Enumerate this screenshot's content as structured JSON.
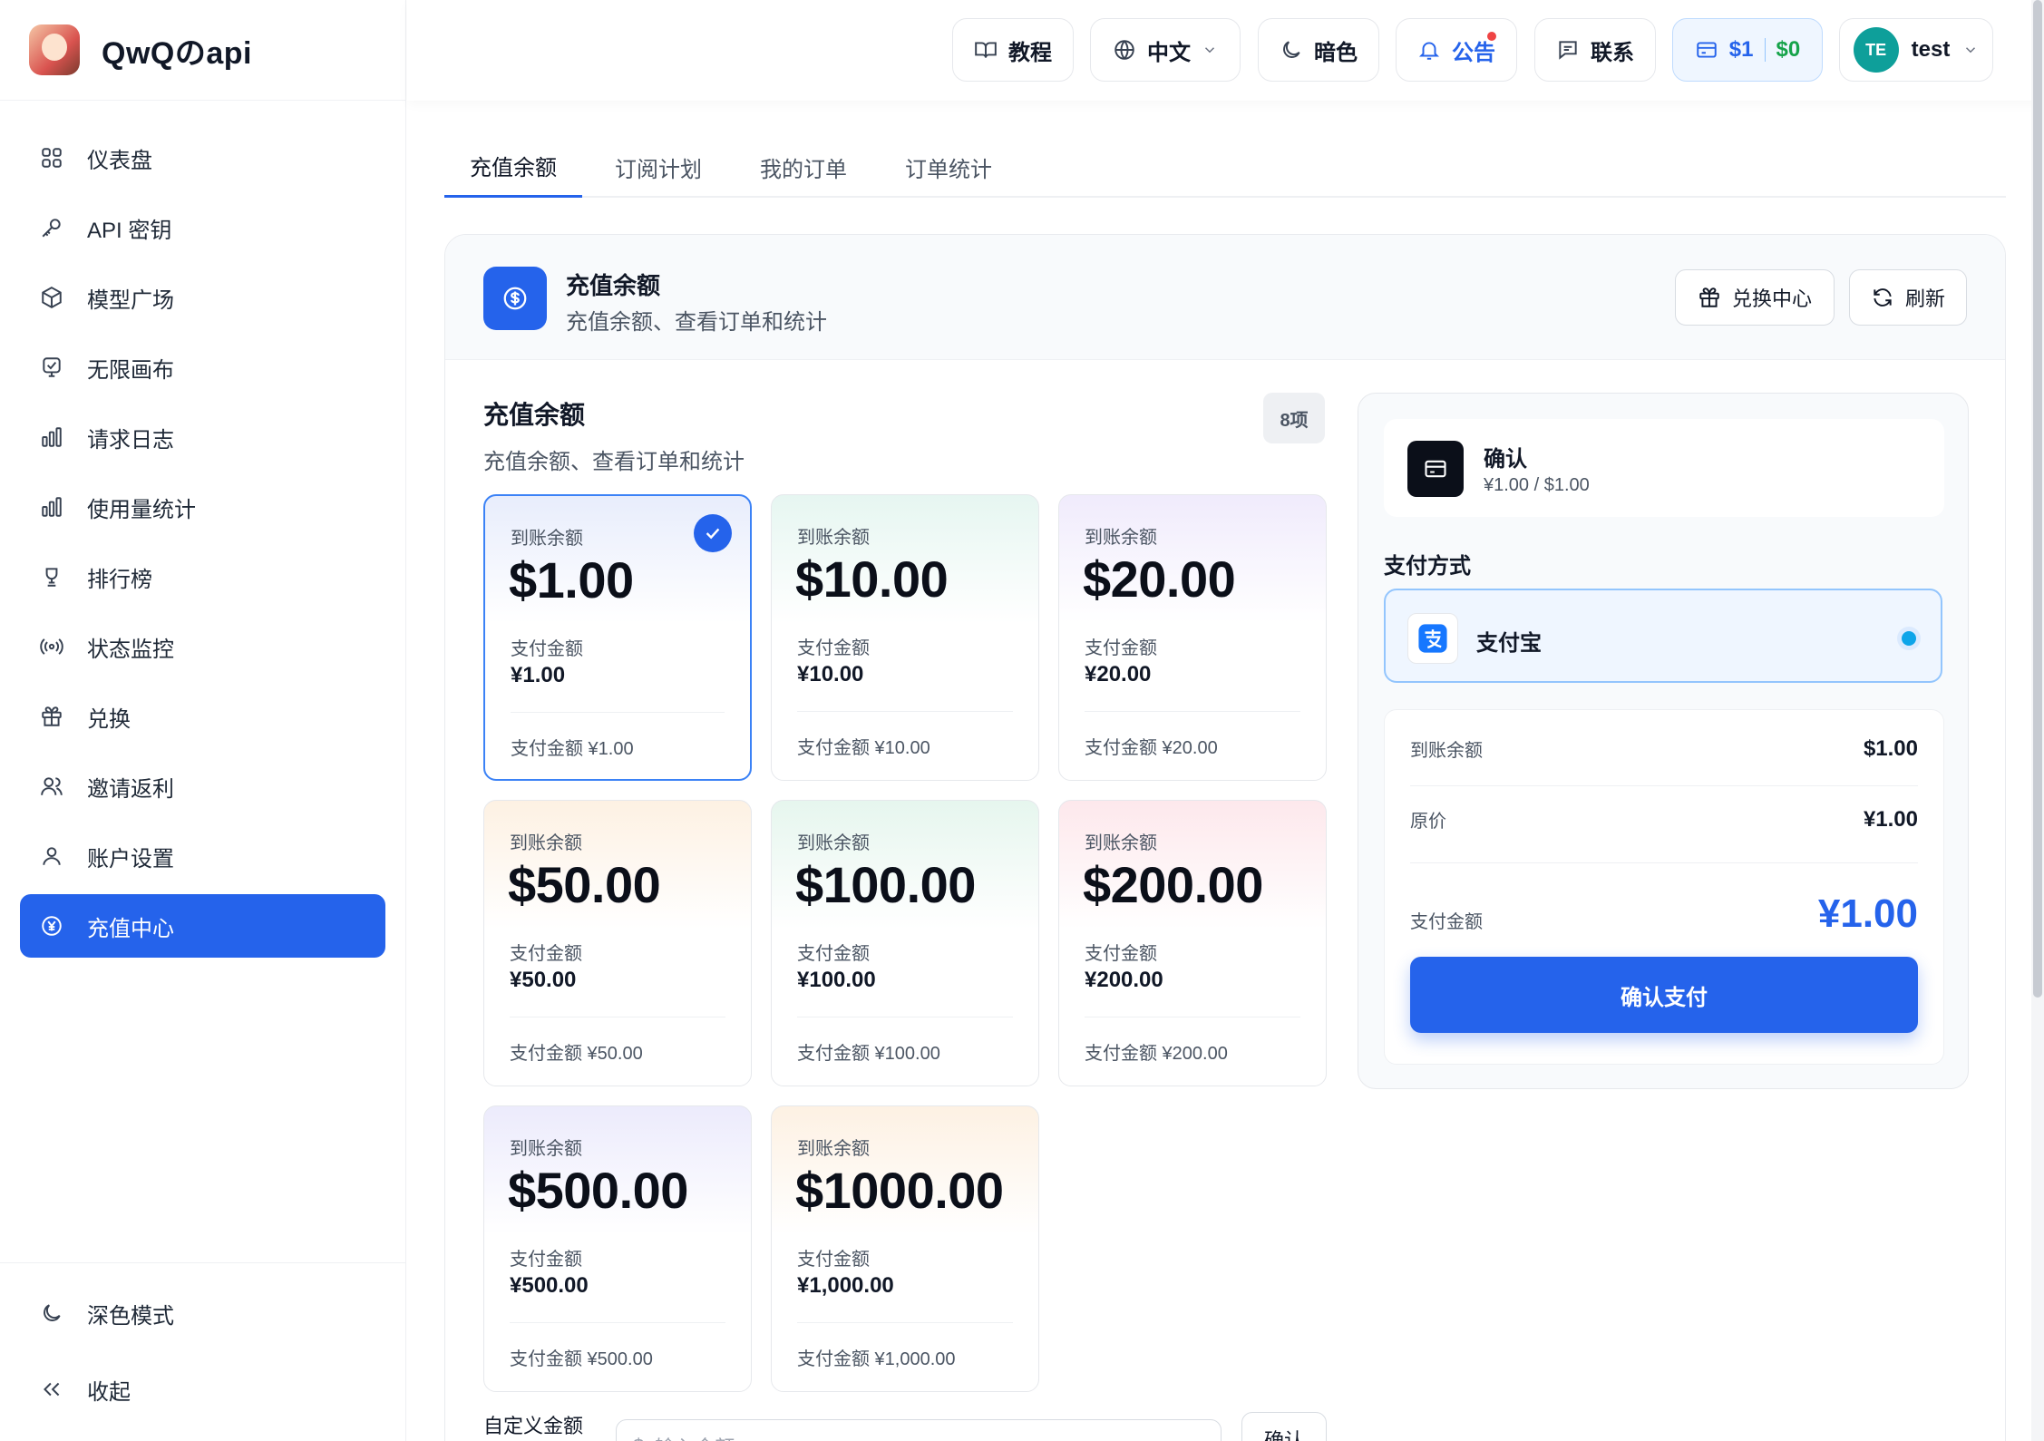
{
  "brand": {
    "name": "QwQのapi"
  },
  "sidebar": {
    "items": [
      {
        "label": "仪表盘",
        "icon": "dashboard-grid-icon"
      },
      {
        "label": "API 密钥",
        "icon": "key-icon"
      },
      {
        "label": "模型广场",
        "icon": "cube-icon"
      },
      {
        "label": "无限画布",
        "icon": "canvas-icon"
      },
      {
        "label": "请求日志",
        "icon": "bar-chart-icon"
      },
      {
        "label": "使用量统计",
        "icon": "bar-chart-icon"
      },
      {
        "label": "排行榜",
        "icon": "trophy-icon"
      },
      {
        "label": "状态监控",
        "icon": "broadcast-icon"
      },
      {
        "label": "兑换",
        "icon": "gift-icon"
      },
      {
        "label": "邀请返利",
        "icon": "users-icon"
      },
      {
        "label": "账户设置",
        "icon": "user-icon"
      },
      {
        "label": "充值中心",
        "icon": "yen-circle-icon",
        "active": true
      }
    ],
    "bottom": {
      "dark_mode": "深色模式",
      "collapse": "收起"
    }
  },
  "header": {
    "tutorial": "教程",
    "language": "中文",
    "dark": "暗色",
    "announcement": "公告",
    "contact": "联系",
    "balance_usd": "$1",
    "balance_other": "$0",
    "avatar_initials": "TE",
    "username": "test"
  },
  "tabs": [
    "充值余额",
    "订阅计划",
    "我的订单",
    "订单统计"
  ],
  "card": {
    "title": "充值余额",
    "subtitle": "充值余额、查看订单和统计",
    "redeem_button": "兑换中心",
    "refresh_button": "刷新"
  },
  "section": {
    "title": "充值余额",
    "subtitle": "充值余额、查看订单和统计",
    "count": "8项"
  },
  "packages": [
    {
      "label": "到账余额",
      "amount": "$1.00",
      "pay_label": "支付金额",
      "pay": "¥1.00",
      "footer": "支付金额 ¥1.00",
      "selected": true
    },
    {
      "label": "到账余额",
      "amount": "$10.00",
      "pay_label": "支付金额",
      "pay": "¥10.00",
      "footer": "支付金额 ¥10.00"
    },
    {
      "label": "到账余额",
      "amount": "$20.00",
      "pay_label": "支付金额",
      "pay": "¥20.00",
      "footer": "支付金额 ¥20.00"
    },
    {
      "label": "到账余额",
      "amount": "$50.00",
      "pay_label": "支付金额",
      "pay": "¥50.00",
      "footer": "支付金额 ¥50.00"
    },
    {
      "label": "到账余额",
      "amount": "$100.00",
      "pay_label": "支付金额",
      "pay": "¥100.00",
      "footer": "支付金额 ¥100.00"
    },
    {
      "label": "到账余额",
      "amount": "$200.00",
      "pay_label": "支付金额",
      "pay": "¥200.00",
      "footer": "支付金额 ¥200.00"
    },
    {
      "label": "到账余额",
      "amount": "$500.00",
      "pay_label": "支付金额",
      "pay": "¥500.00",
      "footer": "支付金额 ¥500.00"
    },
    {
      "label": "到账余额",
      "amount": "$1000.00",
      "pay_label": "支付金额",
      "pay": "¥1,000.00",
      "footer": "支付金额 ¥1,000.00"
    }
  ],
  "custom": {
    "label": "自定义金额",
    "placeholder": "输入金额",
    "button": "确认"
  },
  "checkout": {
    "title": "确认",
    "subtitle": "¥1.00 / $1.00",
    "payment_method_label": "支付方式",
    "payment_method": "支付宝",
    "rows": {
      "credit_label": "到账余额",
      "credit_value": "$1.00",
      "original_label": "原价",
      "original_value": "¥1.00",
      "total_label": "支付金额",
      "total_value": "¥1.00"
    },
    "pay_button": "确认支付"
  },
  "colors": {
    "accent": "#2563eb",
    "balance_green": "#16a34a",
    "card_tints": [
      "#e8edfc",
      "#e6f6f1",
      "#f0ebfc",
      "#fdf1e3",
      "#e6f6ee",
      "#fde8ec",
      "#ecebfc",
      "#fdf1e3"
    ]
  }
}
